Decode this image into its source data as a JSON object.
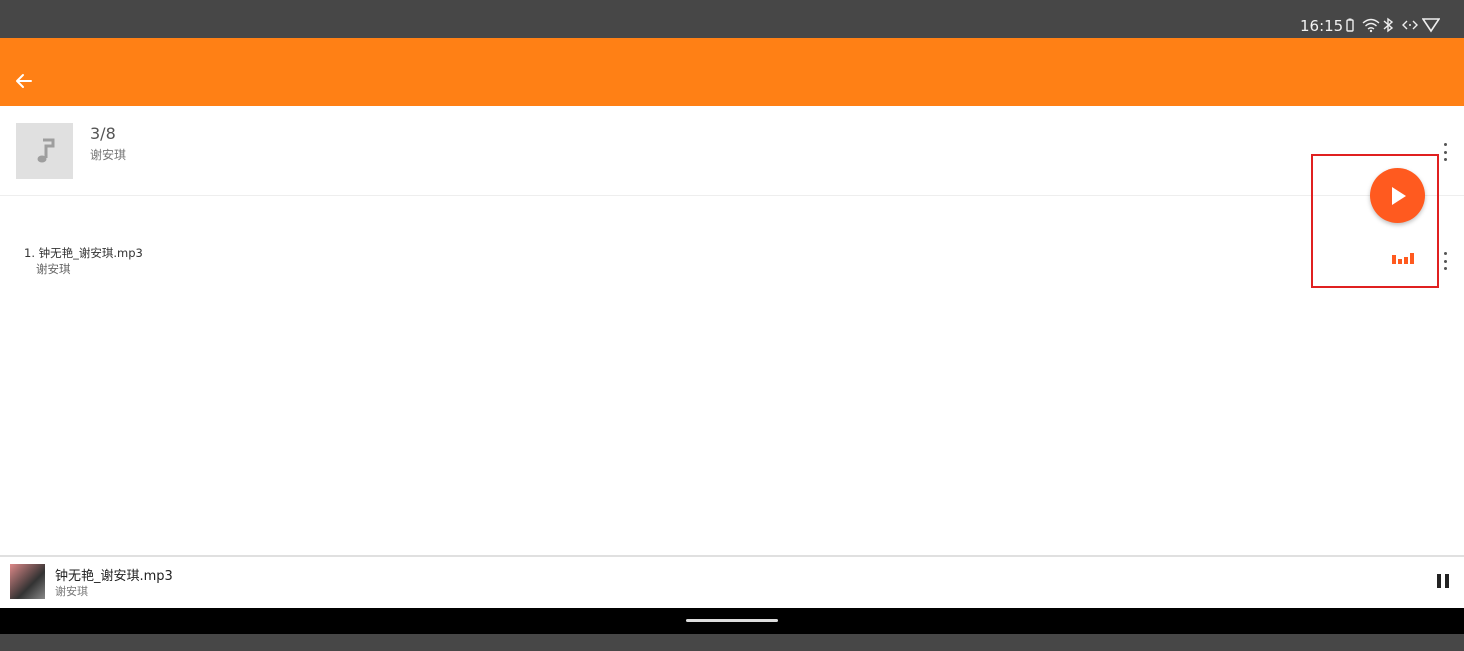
{
  "status_bar": {
    "time": "16:15",
    "icons": [
      "battery-icon",
      "wifi-icon",
      "bluetooth-icon",
      "link-icon",
      "signal-icon"
    ]
  },
  "app_bar": {
    "back_icon": "arrow-left-icon",
    "background_color": "#ff8015"
  },
  "album": {
    "title": "3/8",
    "artist": "谢安琪",
    "art_icon": "music-note-icon"
  },
  "tracks": [
    {
      "title": "1. 钟无艳_谢安琪.mp3",
      "artist": "谢安琪",
      "now_playing": true
    }
  ],
  "fab": {
    "icon": "play-icon",
    "color": "#ff5a1f"
  },
  "mini_player": {
    "title": "钟无艳_谢安琪.mp3",
    "artist": "谢安琪",
    "control_icon": "pause-icon"
  }
}
